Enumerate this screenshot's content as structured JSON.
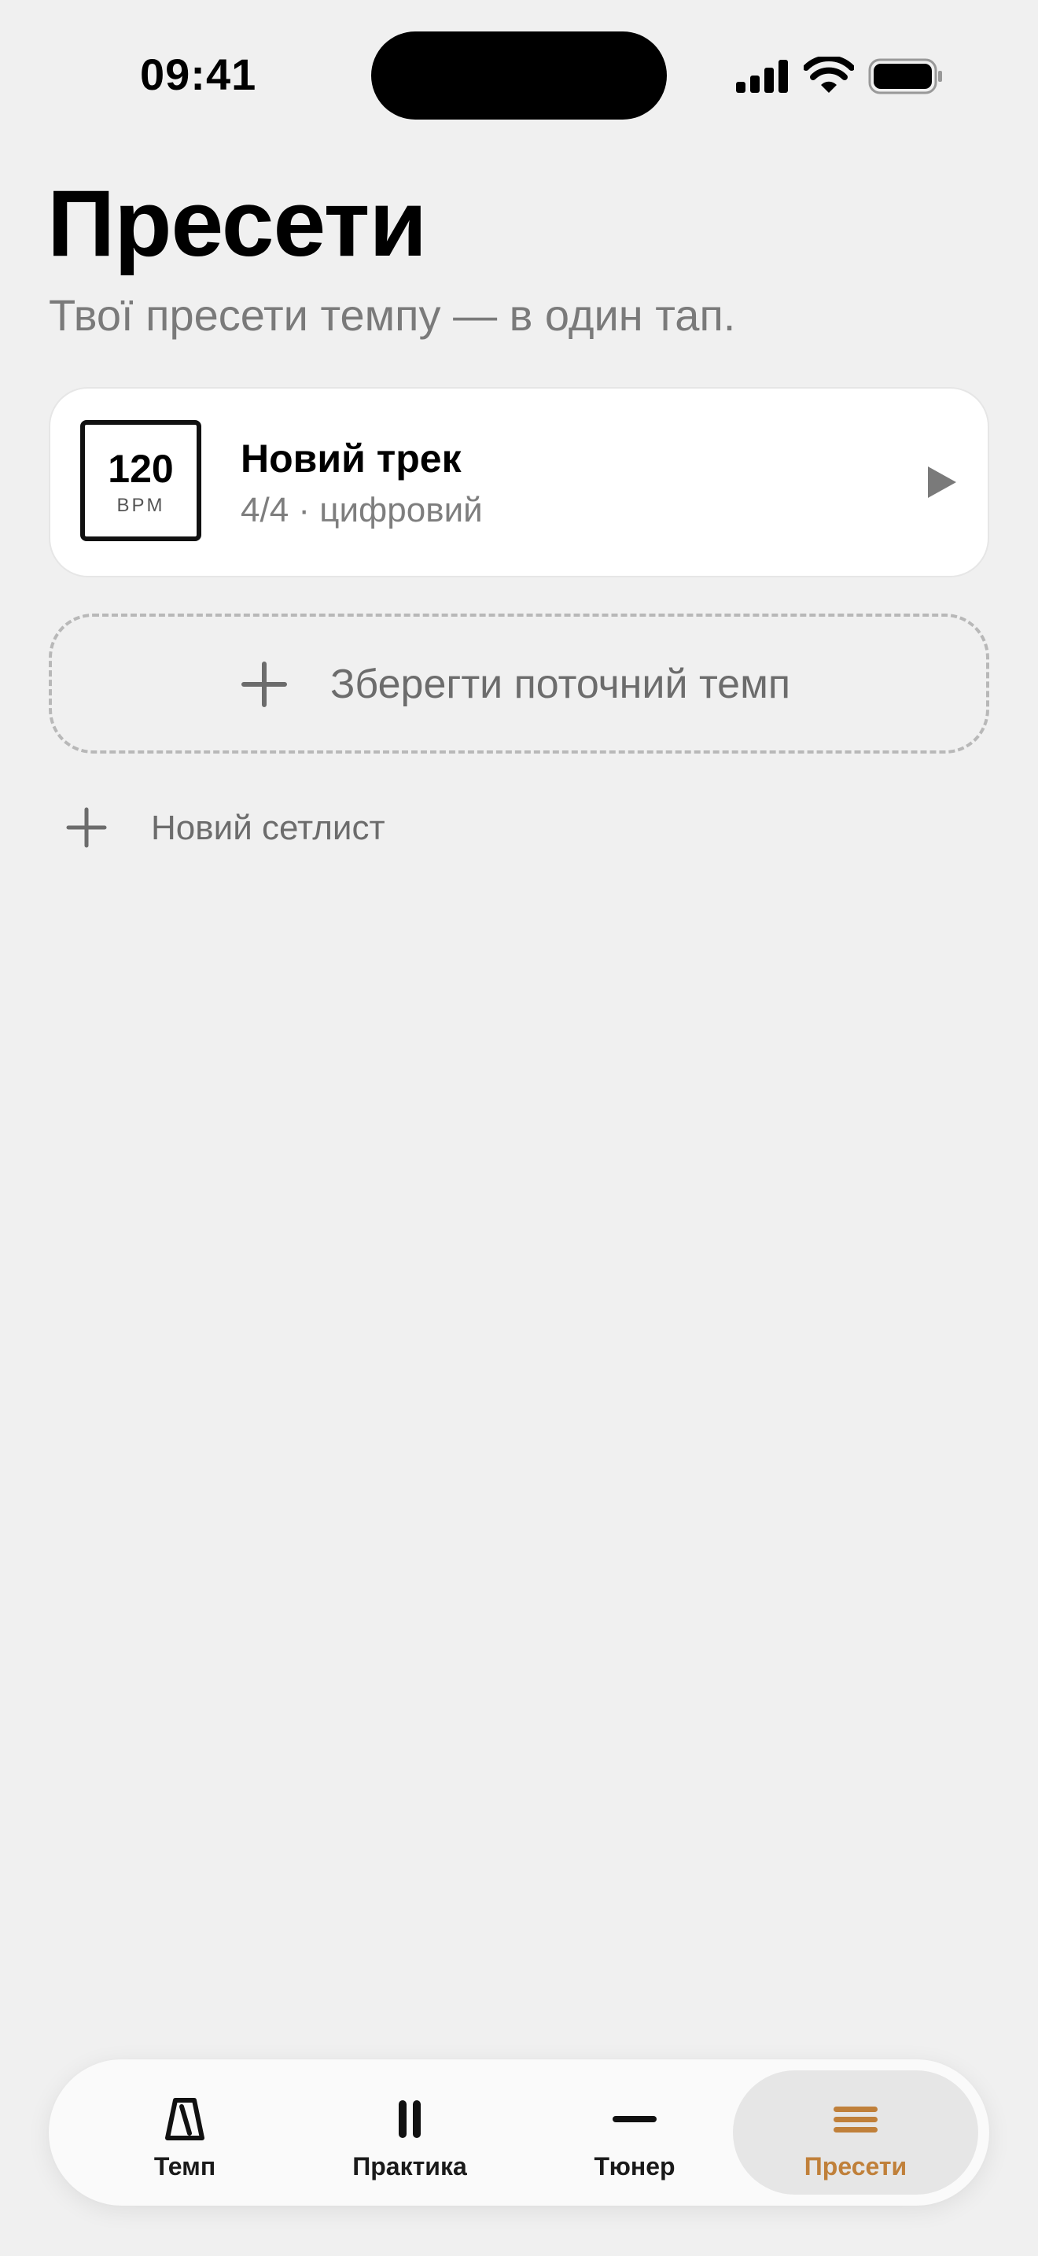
{
  "status_bar": {
    "time": "09:41"
  },
  "header": {
    "title": "Пресети",
    "subtitle": "Твої пресети темпу — в один тап."
  },
  "presets": [
    {
      "bpm": "120",
      "bpm_unit": "BPM",
      "name": "Новий трек",
      "meta": "4/4 · цифровий"
    }
  ],
  "actions": {
    "save_current_tempo": "Зберегти поточний темп",
    "new_setlist": "Новий сетлист"
  },
  "tab_bar": {
    "items": [
      {
        "label": "Темп",
        "icon": "metronome-icon"
      },
      {
        "label": "Практика",
        "icon": "pause-bars-icon"
      },
      {
        "label": "Тюнер",
        "icon": "tuner-line-icon"
      },
      {
        "label": "Пресети",
        "icon": "list-lines-icon"
      }
    ],
    "active": "Пресети",
    "accent_color": "#c0803a"
  }
}
